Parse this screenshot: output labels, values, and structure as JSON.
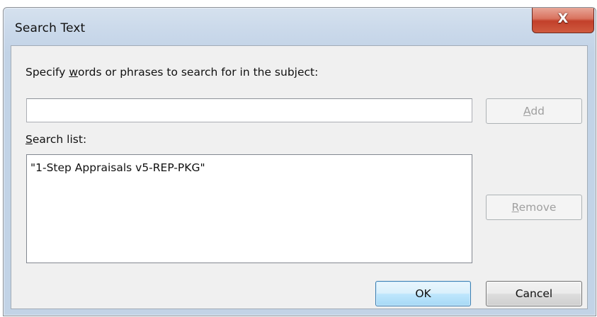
{
  "window": {
    "title": "Search Text",
    "close_symbol": "X"
  },
  "form": {
    "prompt_label": "Specify words or phrases to search for in the subject:",
    "prompt_label_access_key": "w",
    "search_input_value": "",
    "search_list_label": "Search list:",
    "search_list_access_key": "S",
    "search_list_items": [
      "\"1-Step Appraisals v5-REP-PKG\""
    ]
  },
  "buttons": {
    "add": {
      "label": "Add",
      "access_key": "A",
      "enabled": false
    },
    "remove": {
      "label": "Remove",
      "access_key": "R",
      "enabled": false
    },
    "ok": {
      "label": "OK",
      "default": true
    },
    "cancel": {
      "label": "Cancel"
    }
  },
  "icons": {
    "close": "close-icon"
  }
}
